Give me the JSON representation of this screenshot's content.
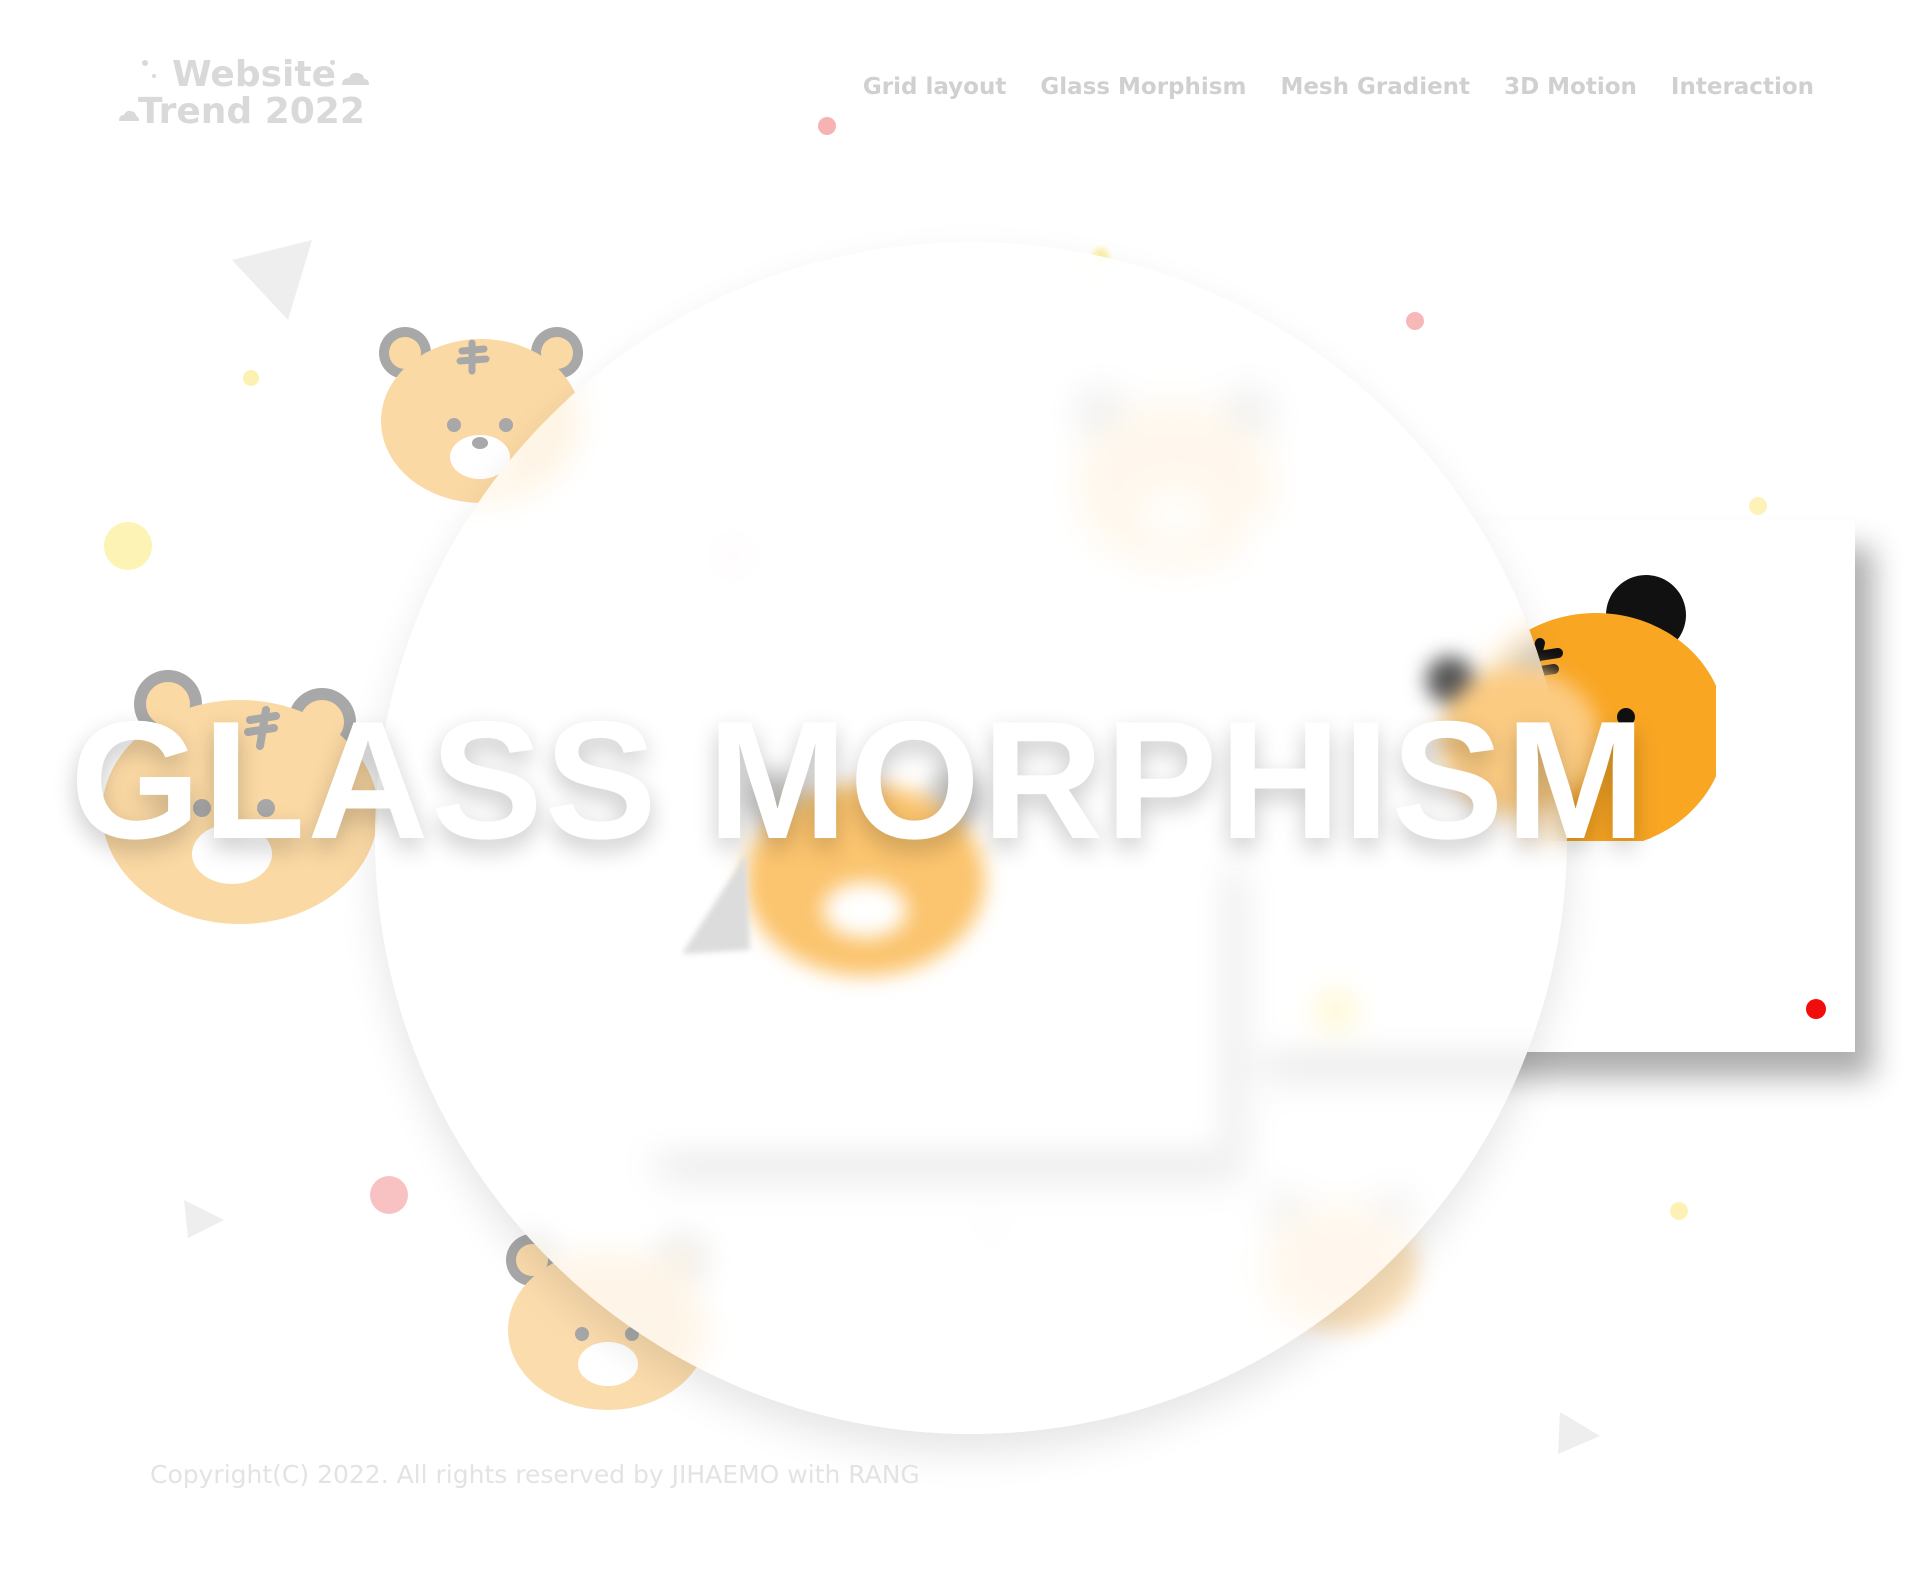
{
  "header": {
    "logo": {
      "line1": "Website",
      "line2": "Trend 2022"
    },
    "nav": [
      {
        "label": "Grid layout"
      },
      {
        "label": "Glass Morphism"
      },
      {
        "label": "Mesh Gradient"
      },
      {
        "label": "3D Motion"
      },
      {
        "label": "Interaction"
      }
    ]
  },
  "hero": {
    "headline": "GLASS MORPHISM"
  },
  "footer": {
    "copyright": "Copyright(C) 2022. All rights reserved by JIHAEMO with RANG"
  },
  "colors": {
    "tiger_orange": "#f9a623",
    "tiger_faded": "#fbd9a4",
    "ear_gray": "#a6a6a6",
    "dot_pink": "#f7a8a8",
    "dot_yellow": "#fbe77a",
    "dot_red": "#f20d0d",
    "muted_text": "#d0d0d0"
  },
  "icons": {
    "mascot": "tiger-face-icon",
    "shapes": [
      "triangle-shape",
      "dot-shape"
    ]
  }
}
